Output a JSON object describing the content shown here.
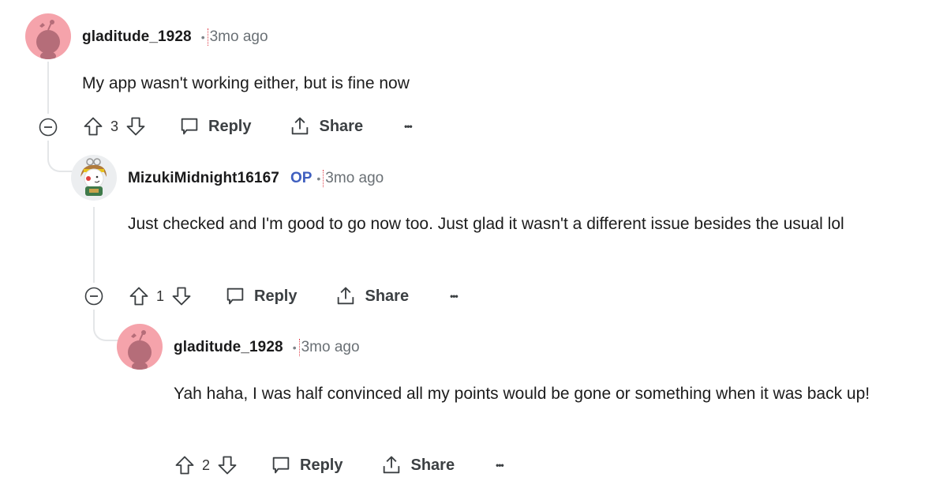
{
  "comments": [
    {
      "username": "gladitude_1928",
      "op_badge": "",
      "separator": "•",
      "time": "3mo ago",
      "avatar": "snoo-avatar-pink",
      "body": "My app wasn't working either, but is fine now",
      "votes": "3",
      "reply_label": "Reply",
      "share_label": "Share",
      "more_label": "•••"
    },
    {
      "username": "MizukiMidnight16167",
      "op_badge": "OP",
      "separator": "•",
      "time": "3mo ago",
      "avatar": "snoo-avatar-custom",
      "body": "Just checked and I'm good to go now too. Just glad it wasn't a different issue besides the usual lol",
      "votes": "1",
      "reply_label": "Reply",
      "share_label": "Share",
      "more_label": "•••"
    },
    {
      "username": "gladitude_1928",
      "op_badge": "",
      "separator": "•",
      "time": "3mo ago",
      "avatar": "snoo-avatar-pink",
      "body": "Yah haha, I was half convinced all my points would be gone or something when it was back up!",
      "votes": "2",
      "reply_label": "Reply",
      "share_label": "Share",
      "more_label": "•••"
    }
  ],
  "colors": {
    "op_badge": "#3f5fbf",
    "avatar_pink": "#f5a3ab",
    "thread_line": "#e4e6e8"
  }
}
